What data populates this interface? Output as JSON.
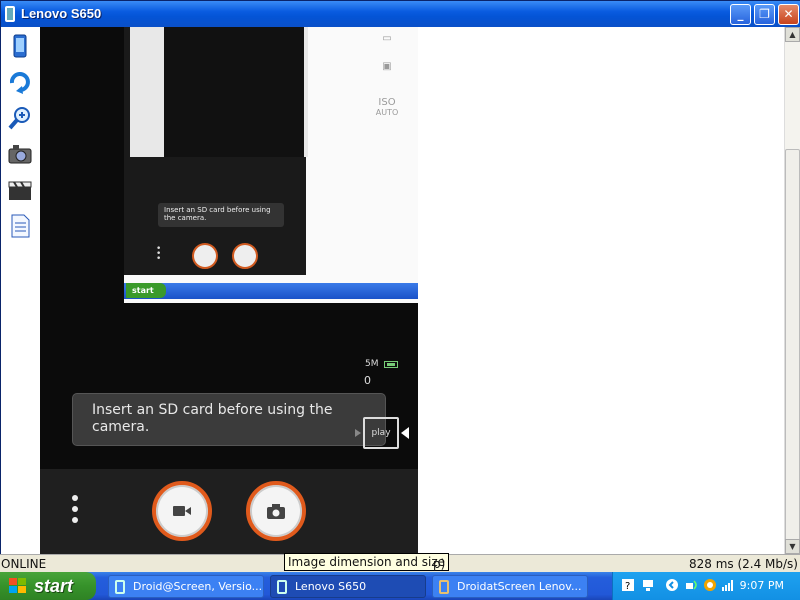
{
  "window": {
    "title": "Lenovo S650",
    "minimize_label": "_",
    "maximize_label": "❐",
    "close_label": "✕"
  },
  "toolbar": {
    "items": [
      {
        "name": "device-icon"
      },
      {
        "name": "rotate-icon"
      },
      {
        "name": "zoom-icon"
      },
      {
        "name": "camera-icon"
      },
      {
        "name": "video-clapper-icon"
      },
      {
        "name": "document-icon"
      }
    ]
  },
  "phone": {
    "toast": "Insert an SD card before using the camera.",
    "resolution": "5M",
    "photo_count": "0",
    "thumbnail_label": "play",
    "side_iso": "ISO",
    "side_iso_sub": "AUTO",
    "mini": {
      "start": "start",
      "toast": "Insert an SD card before using the camera."
    }
  },
  "statusbar": {
    "left": "ONLINE",
    "tooltip": "Image dimension and size",
    "tooltip_overflow": "p)",
    "latency": "828 ms (2.4 Mb/s)"
  },
  "taskbar": {
    "start": "start",
    "tasks": [
      {
        "label": "Droid@Screen, Versio...",
        "active": false
      },
      {
        "label": "Lenovo S650",
        "active": true
      },
      {
        "label": "DroidatScreen Lenov...",
        "active": false
      }
    ],
    "clock": "9:07 PM"
  }
}
